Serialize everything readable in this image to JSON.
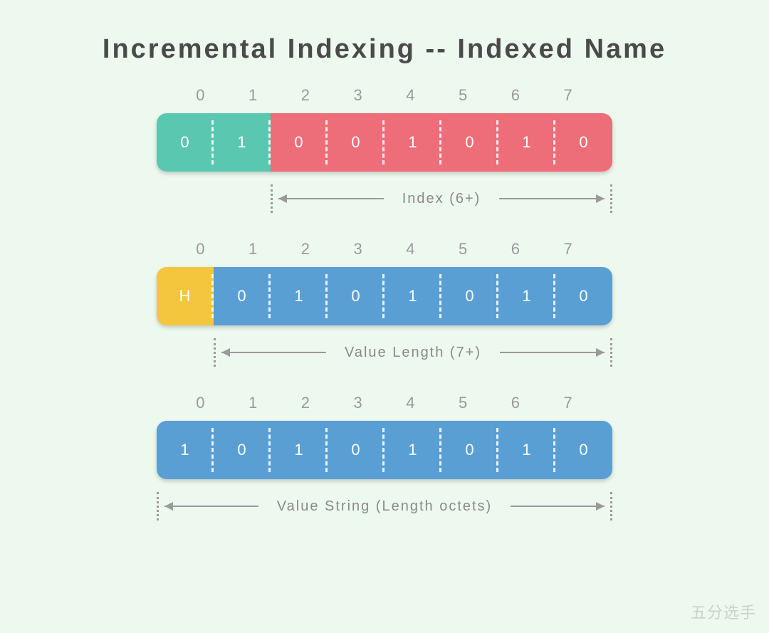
{
  "title": "Incremental Indexing -- Indexed Name",
  "bit_headers": [
    "0",
    "1",
    "2",
    "3",
    "4",
    "5",
    "6",
    "7"
  ],
  "rows": [
    {
      "cells": [
        {
          "v": "0",
          "c": "teal"
        },
        {
          "v": "1",
          "c": "teal"
        },
        {
          "v": "0",
          "c": "pink"
        },
        {
          "v": "0",
          "c": "pink"
        },
        {
          "v": "1",
          "c": "pink"
        },
        {
          "v": "0",
          "c": "pink"
        },
        {
          "v": "1",
          "c": "pink"
        },
        {
          "v": "0",
          "c": "pink"
        }
      ],
      "annotation": {
        "label": "Index (6+)",
        "start": 2,
        "end": 8
      }
    },
    {
      "cells": [
        {
          "v": "H",
          "c": "yellow"
        },
        {
          "v": "0",
          "c": "blue"
        },
        {
          "v": "1",
          "c": "blue"
        },
        {
          "v": "0",
          "c": "blue"
        },
        {
          "v": "1",
          "c": "blue"
        },
        {
          "v": "0",
          "c": "blue"
        },
        {
          "v": "1",
          "c": "blue"
        },
        {
          "v": "0",
          "c": "blue"
        }
      ],
      "annotation": {
        "label": "Value Length (7+)",
        "start": 1,
        "end": 8
      }
    },
    {
      "cells": [
        {
          "v": "1",
          "c": "blue"
        },
        {
          "v": "0",
          "c": "blue"
        },
        {
          "v": "1",
          "c": "blue"
        },
        {
          "v": "0",
          "c": "blue"
        },
        {
          "v": "1",
          "c": "blue"
        },
        {
          "v": "0",
          "c": "blue"
        },
        {
          "v": "1",
          "c": "blue"
        },
        {
          "v": "0",
          "c": "blue"
        }
      ],
      "annotation": {
        "label": "Value String (Length octets)",
        "start": 0,
        "end": 8
      }
    }
  ],
  "watermark": "五分选手"
}
